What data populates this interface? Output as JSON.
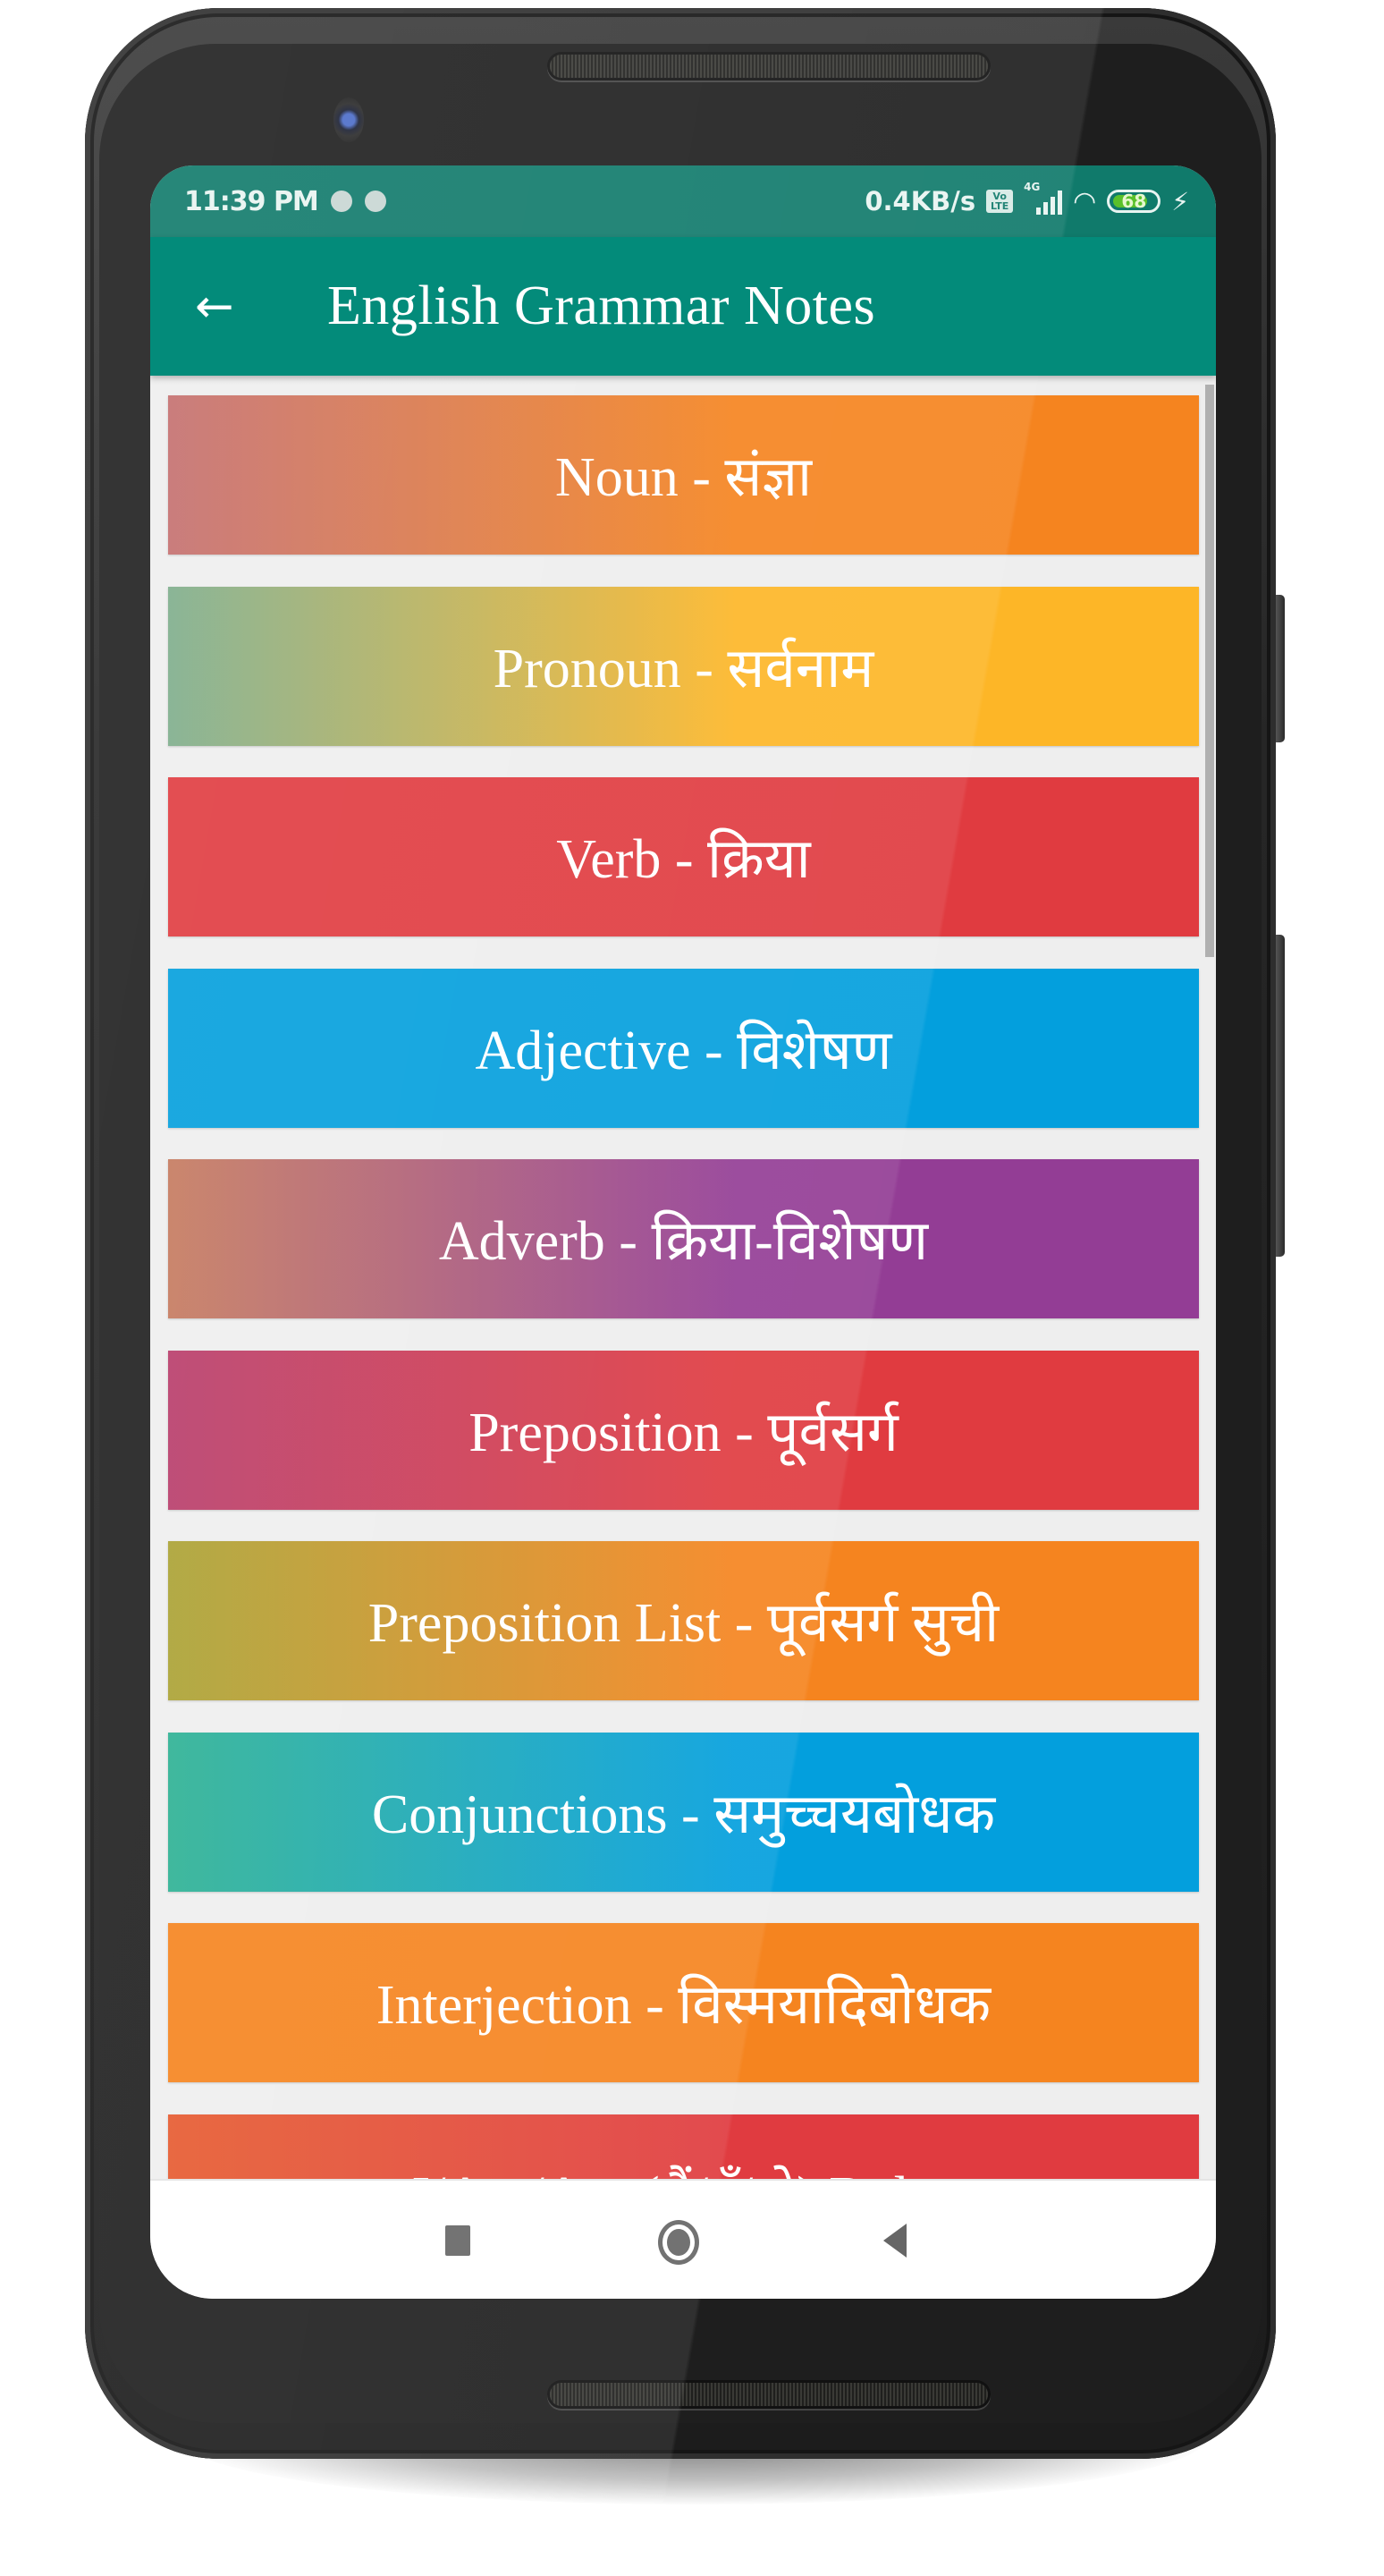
{
  "status_bar": {
    "time": "11:39 PM",
    "network_speed": "0.4KB/s",
    "volte_label_top": "Vo",
    "volte_label_bottom": "LTE",
    "network_type": "4G",
    "battery_percent": "68",
    "icons": [
      "notification-dot-icon",
      "notification-dot-icon",
      "volte-icon",
      "signal-icon",
      "wifi-icon",
      "battery-icon",
      "charging-bolt-icon"
    ]
  },
  "toolbar": {
    "back_icon": "arrow-left-icon",
    "title": "English Grammar Notes"
  },
  "topics": [
    {
      "label": "Noun - संज्ञा",
      "color_start": "#c46f6f",
      "color_end": "#f5841f"
    },
    {
      "label": "Pronoun - सर्वनाम",
      "color_start": "#7ead8c",
      "color_end": "#fdb627"
    },
    {
      "label": "Verb - क्रिया",
      "color_start": "#e03b40",
      "color_end": "#e03b40"
    },
    {
      "label": "Adjective - विशेषण",
      "color_start": "#039fdd",
      "color_end": "#039fdd"
    },
    {
      "label": "Adverb - क्रिया-विशेषण",
      "color_start": "#c57a5e",
      "color_end": "#933d95"
    },
    {
      "label": "Preposition - पूर्वसर्ग",
      "color_start": "#b83c6a",
      "color_end": "#e03b40"
    },
    {
      "label": "Preposition List - पूर्वसर्ग सुची",
      "color_start": "#aaa233",
      "color_end": "#f5841f"
    },
    {
      "label": "Conjunctions - समुच्चयबोधक",
      "color_start": "#2db193",
      "color_end": "#039fdd"
    },
    {
      "label": "Interjection - विस्मयादिबोधक",
      "color_start": "#f5841f",
      "color_end": "#f5841f"
    },
    {
      "label": "I/Am/Are (मैं/हूँ/हो) Rules",
      "color_start": "#e65a2f",
      "color_end": "#e03b40"
    }
  ],
  "nav_bar": {
    "recents_icon": "square-recents-icon",
    "home_icon": "circle-home-icon",
    "back_icon": "triangle-back-icon"
  },
  "colors": {
    "status_bar": "#107a6b",
    "toolbar": "#038b7a",
    "list_background": "#eeeeee"
  }
}
